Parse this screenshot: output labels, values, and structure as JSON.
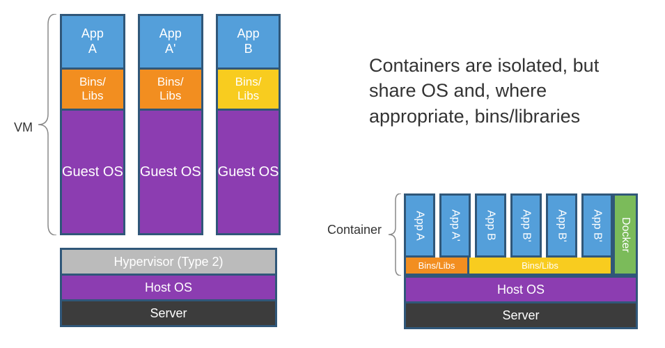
{
  "heading": "Containers are isolated, but share OS and, where appropriate, bins/libraries",
  "vm": {
    "label": "VM",
    "columns": [
      {
        "app_l1": "App",
        "app_l2": "A",
        "libs_l1": "Bins/",
        "libs_l2": "Libs",
        "libs_color": "orange",
        "guest_l1": "Guest",
        "guest_l2": "OS"
      },
      {
        "app_l1": "App",
        "app_l2": "A'",
        "libs_l1": "Bins/",
        "libs_l2": "Libs",
        "libs_color": "orange",
        "guest_l1": "Guest",
        "guest_l2": "OS"
      },
      {
        "app_l1": "App",
        "app_l2": "B",
        "libs_l1": "Bins/",
        "libs_l2": "Libs",
        "libs_color": "yellow",
        "guest_l1": "Guest",
        "guest_l2": "OS"
      }
    ],
    "base": {
      "hypervisor": "Hypervisor (Type 2)",
      "host": "Host OS",
      "server": "Server"
    }
  },
  "container": {
    "label": "Container",
    "apps": [
      {
        "label": "App A"
      },
      {
        "label": "App A'"
      },
      {
        "label": "App B"
      },
      {
        "label": "App B'"
      },
      {
        "label": "App B'"
      },
      {
        "label": "App B'"
      }
    ],
    "libs": [
      {
        "label": "Bins/Libs",
        "color": "orange"
      },
      {
        "label": "Bins/Libs",
        "color": "yellow"
      }
    ],
    "docker": "Docker",
    "base": {
      "host": "Host OS",
      "server": "Server"
    }
  },
  "colors": {
    "blue": "#549fda",
    "border": "#305779",
    "purple": "#8c3db1",
    "orange": "#f28e20",
    "yellow": "#f8cc1f",
    "green": "#7bbb5a",
    "gray": "#bbbbbb",
    "dark": "#3c3c3c"
  }
}
